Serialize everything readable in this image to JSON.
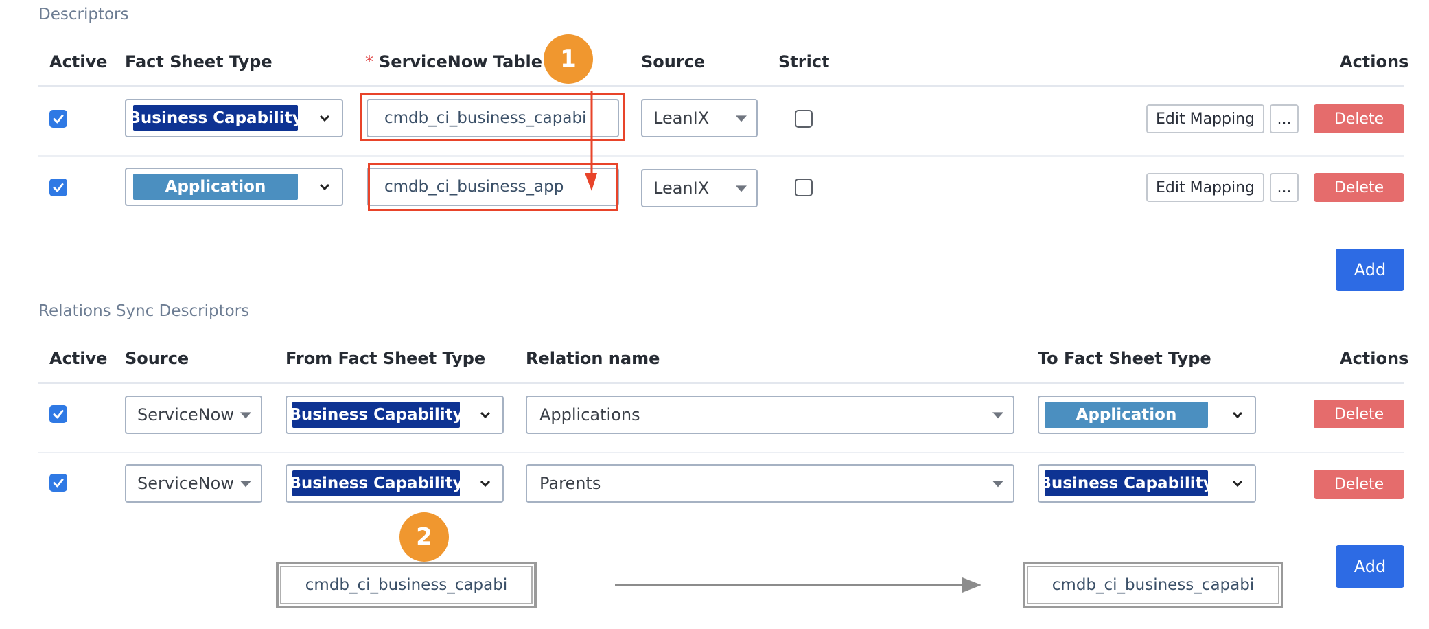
{
  "colors": {
    "business_capability": "#0e3393",
    "application": "#4b8fc0",
    "accent_blue": "#2d6be4",
    "delete_red": "#e56c6c",
    "callout_red": "#e8442a",
    "callout_orange": "#f0972f"
  },
  "descriptors": {
    "title": "Descriptors",
    "headers": {
      "active": "Active",
      "fact_sheet_type": "Fact Sheet Type",
      "required_mark": "*",
      "servicenow_table": "ServiceNow Table",
      "source": "Source",
      "strict": "Strict",
      "actions": "Actions"
    },
    "rows": [
      {
        "active": true,
        "fact_sheet_type": "Business Capability",
        "servicenow_table": "cmdb_ci_business_capabi",
        "source": "LeanIX",
        "strict": false,
        "edit_mapping": "Edit Mapping",
        "more": "...",
        "delete": "Delete"
      },
      {
        "active": true,
        "fact_sheet_type": "Application",
        "servicenow_table": "cmdb_ci_business_app",
        "source": "LeanIX",
        "strict": false,
        "edit_mapping": "Edit Mapping",
        "more": "...",
        "delete": "Delete"
      }
    ],
    "add": "Add"
  },
  "relations": {
    "title": "Relations Sync Descriptors",
    "headers": {
      "active": "Active",
      "source": "Source",
      "from_fact_sheet_type": "From Fact Sheet Type",
      "relation_name": "Relation name",
      "to_fact_sheet_type": "To Fact Sheet Type",
      "actions": "Actions"
    },
    "rows": [
      {
        "active": true,
        "source": "ServiceNow",
        "from_fact_sheet_type": "Business Capability",
        "relation_name": "Applications",
        "to_fact_sheet_type": "Application",
        "delete": "Delete"
      },
      {
        "active": true,
        "source": "ServiceNow",
        "from_fact_sheet_type": "Business Capability",
        "relation_name": "Parents",
        "to_fact_sheet_type": "Business Capability",
        "delete": "Delete"
      }
    ],
    "add": "Add"
  },
  "annotations": {
    "callout_1": "1",
    "callout_2": "2",
    "from_table": "cmdb_ci_business_capabi",
    "to_table": "cmdb_ci_business_capabi"
  }
}
